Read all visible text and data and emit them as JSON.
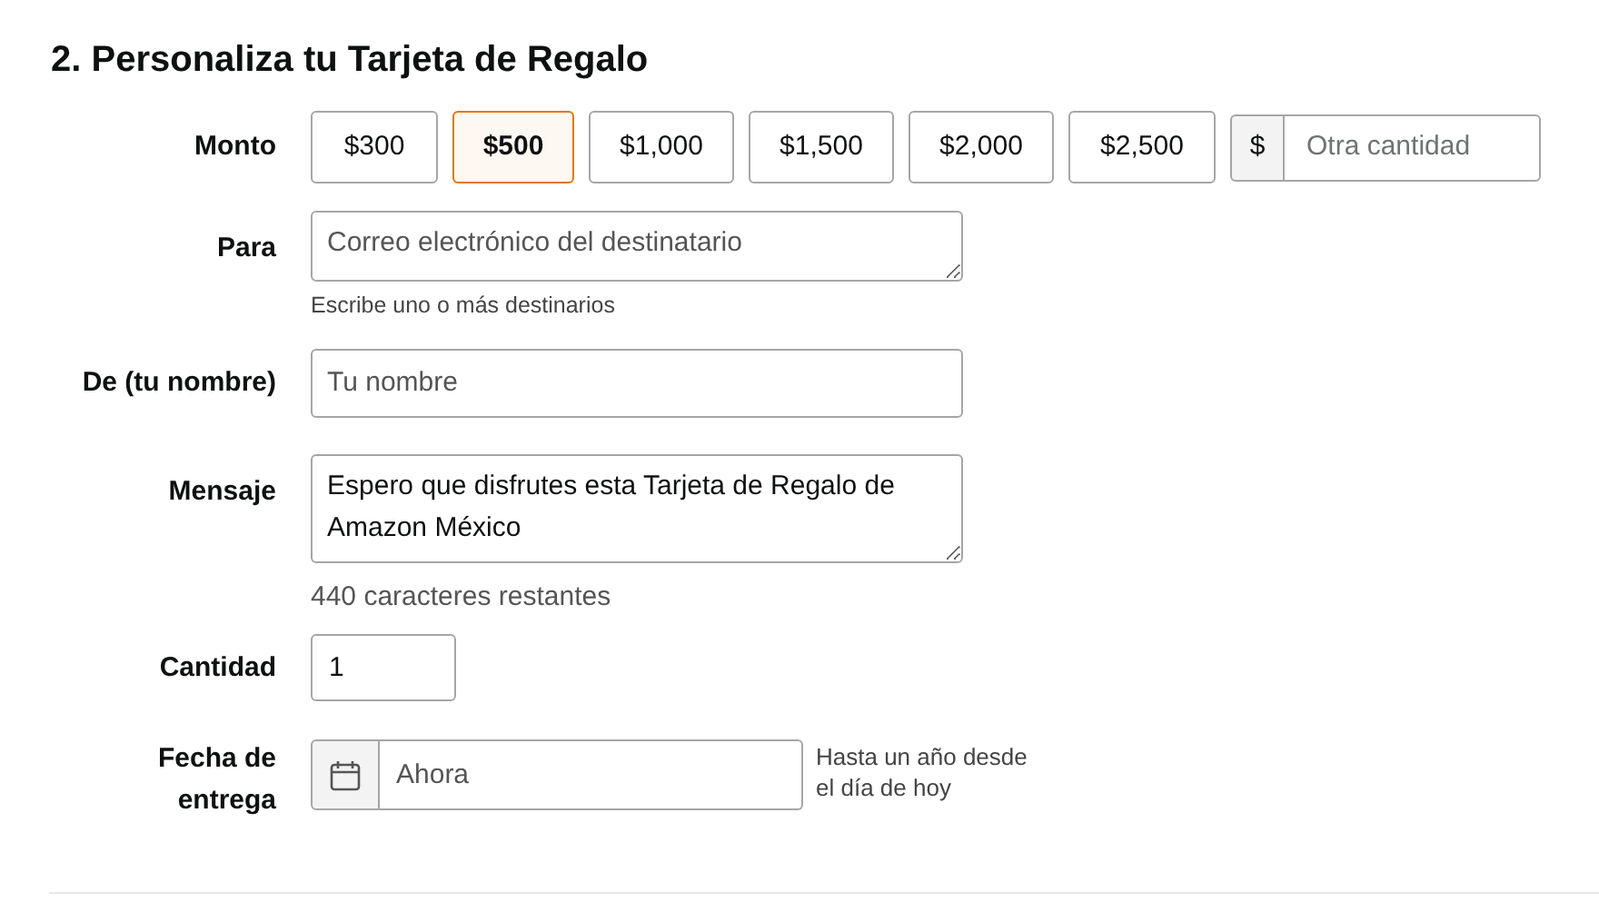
{
  "heading": "2. Personaliza tu Tarjeta de Regalo",
  "amount": {
    "label": "Monto",
    "options": [
      {
        "label": "$300",
        "selected": false
      },
      {
        "label": "$500",
        "selected": true
      },
      {
        "label": "$1,000",
        "selected": false
      },
      {
        "label": "$1,500",
        "selected": false
      },
      {
        "label": "$2,000",
        "selected": false
      },
      {
        "label": "$2,500",
        "selected": false
      }
    ],
    "custom": {
      "prefix": "$",
      "placeholder": "Otra cantidad"
    }
  },
  "to": {
    "label": "Para",
    "placeholder": "Correo electrónico del destinatario",
    "hint": "Escribe uno o más destinarios"
  },
  "from": {
    "label": "De (tu nombre)",
    "placeholder": "Tu nombre"
  },
  "message": {
    "label": "Mensaje",
    "value": "Espero que disfrutes esta Tarjeta de Regalo de Amazon México",
    "counter": "440 caracteres restantes"
  },
  "quantity": {
    "label": "Cantidad",
    "value": "1"
  },
  "delivery": {
    "label": "Fecha de entrega",
    "placeholder": "Ahora",
    "note": "Hasta un año desde el día de hoy"
  }
}
